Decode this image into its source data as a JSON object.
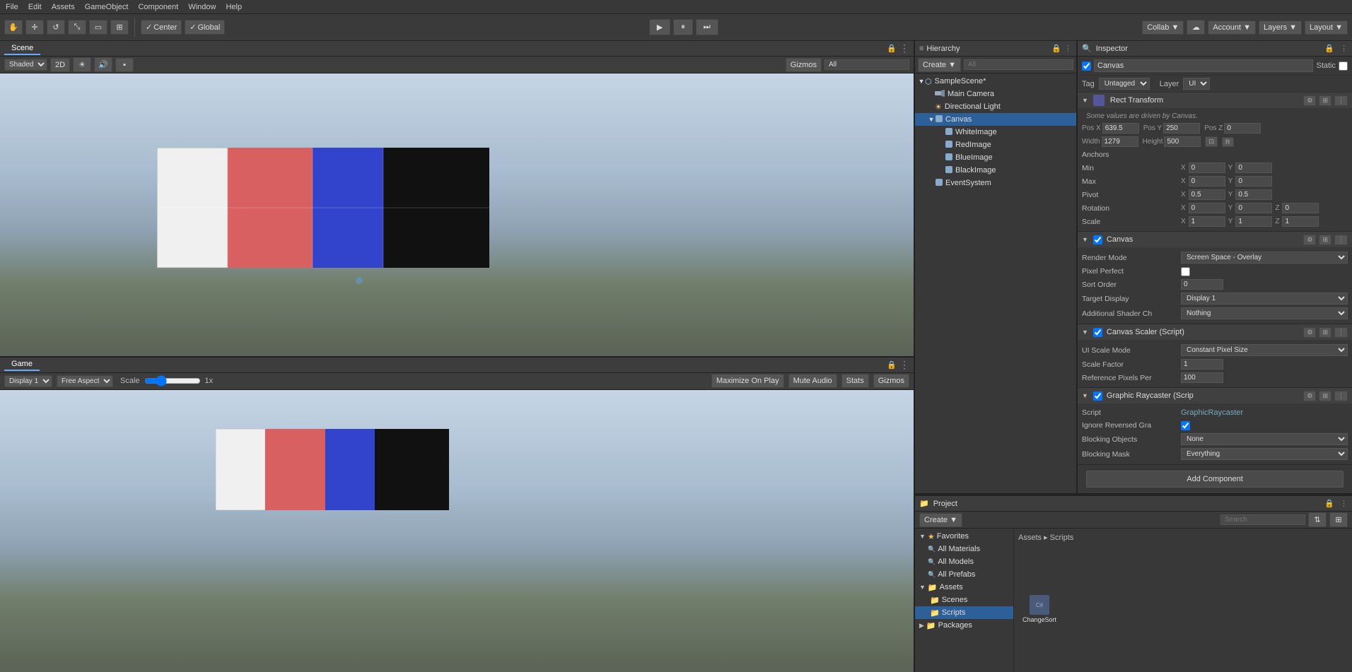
{
  "menubar": {
    "items": [
      "File",
      "Edit",
      "Assets",
      "GameObject",
      "Component",
      "Window",
      "Help"
    ]
  },
  "toolbar": {
    "transform_buttons": [
      "hand",
      "move",
      "rotate",
      "scale",
      "rect",
      "transform"
    ],
    "pivot_label": "Center",
    "space_label": "Global",
    "collab_label": "Collab ▼",
    "account_label": "Account ▼",
    "layers_label": "Layers ▼",
    "layout_label": "Layout ▼"
  },
  "scene": {
    "tab_label": "Scene",
    "shading_mode": "Shaded",
    "is_2d": "2D",
    "gizmos_label": "Gizmos",
    "search_placeholder": "All"
  },
  "game": {
    "tab_label": "Game",
    "display_label": "Display 1",
    "aspect_label": "Free Aspect",
    "scale_label": "Scale",
    "scale_value": "1x",
    "maximize_label": "Maximize On Play",
    "mute_label": "Mute Audio",
    "stats_label": "Stats",
    "gizmos_label": "Gizmos"
  },
  "hierarchy": {
    "header_label": "Hierarchy",
    "create_label": "Create ▼",
    "search_placeholder": "All",
    "items": [
      {
        "id": "scene",
        "label": "SampleScene*",
        "depth": 0,
        "has_arrow": true,
        "expanded": true,
        "icon": "scene"
      },
      {
        "id": "main-camera",
        "label": "Main Camera",
        "depth": 1,
        "has_arrow": false,
        "icon": "camera"
      },
      {
        "id": "directional-light",
        "label": "Directional Light",
        "depth": 1,
        "has_arrow": false,
        "icon": "light"
      },
      {
        "id": "canvas",
        "label": "Canvas",
        "depth": 1,
        "has_arrow": true,
        "expanded": true,
        "icon": "gameobj",
        "selected": true
      },
      {
        "id": "white-image",
        "label": "WhiteImage",
        "depth": 2,
        "has_arrow": false,
        "icon": "gameobj"
      },
      {
        "id": "red-image",
        "label": "RedImage",
        "depth": 2,
        "has_arrow": false,
        "icon": "gameobj"
      },
      {
        "id": "blue-image",
        "label": "BlueImage",
        "depth": 2,
        "has_arrow": false,
        "icon": "gameobj"
      },
      {
        "id": "black-image",
        "label": "BlackImage",
        "depth": 2,
        "has_arrow": false,
        "icon": "gameobj"
      },
      {
        "id": "event-system",
        "label": "EventSystem",
        "depth": 1,
        "has_arrow": false,
        "icon": "gameobj"
      }
    ]
  },
  "inspector": {
    "header_label": "Inspector",
    "object_name": "Canvas",
    "is_static": false,
    "tag_label": "Tag",
    "tag_value": "Untagged",
    "layer_label": "Layer",
    "layer_value": "UI",
    "rect_transform": {
      "title": "Rect Transform",
      "note": "Some values are driven by Canvas.",
      "pos_x": "639.5",
      "pos_y": "250",
      "pos_z": "0",
      "width": "1279",
      "height": "500",
      "anchors_min_x": "0",
      "anchors_min_y": "0",
      "anchors_max_x": "0",
      "anchors_max_y": "0",
      "pivot_x": "0.5",
      "pivot_y": "0.5",
      "rotation_x": "0",
      "rotation_y": "0",
      "rotation_z": "0",
      "scale_x": "1",
      "scale_y": "1",
      "scale_z": "1"
    },
    "canvas": {
      "title": "Canvas",
      "render_mode_label": "Render Mode",
      "render_mode_value": "Screen Space - Overlay",
      "pixel_perfect_label": "Pixel Perfect",
      "pixel_perfect_value": false,
      "sort_order_label": "Sort Order",
      "sort_order_value": "0",
      "target_display_label": "Target Display",
      "target_display_value": "Display 1",
      "additional_shader_label": "Additional Shader Ch",
      "additional_shader_value": "Nothing"
    },
    "canvas_scaler": {
      "title": "Canvas Scaler (Script)",
      "ui_scale_mode_label": "UI Scale Mode",
      "ui_scale_mode_value": "Constant Pixel Size",
      "scale_factor_label": "Scale Factor",
      "scale_factor_value": "1",
      "reference_pixels_label": "Reference Pixels Per",
      "reference_pixels_value": "100"
    },
    "graphic_raycaster": {
      "title": "Graphic Raycaster (Scrip",
      "script_label": "Script",
      "script_value": "GraphicRaycaster",
      "ignore_reversed_label": "Ignore Reversed Gra",
      "ignore_reversed_value": true,
      "blocking_objects_label": "Blocking Objects",
      "blocking_objects_value": "None",
      "blocking_mask_label": "Blocking Mask",
      "blocking_mask_value": "Everything"
    },
    "add_component_label": "Add Component"
  },
  "project": {
    "header_label": "Project",
    "create_label": "Create ▼",
    "search_placeholder": "Search",
    "favorites": {
      "label": "Favorites",
      "items": [
        "All Materials",
        "All Models",
        "All Prefabs"
      ]
    },
    "assets_path": "Assets ▸ Scripts",
    "assets_items": [
      {
        "label": "Scenes",
        "type": "folder"
      },
      {
        "label": "Scripts",
        "type": "folder",
        "selected": true
      }
    ],
    "packages": {
      "label": "Packages"
    },
    "files": [
      {
        "label": "ChangeSort"
      }
    ]
  },
  "colors": {
    "selected_blue": "#2d6098",
    "accent_blue": "#6af",
    "folder_yellow": "#e8c060",
    "bg_dark": "#383838",
    "bg_darker": "#2a2a2a"
  }
}
